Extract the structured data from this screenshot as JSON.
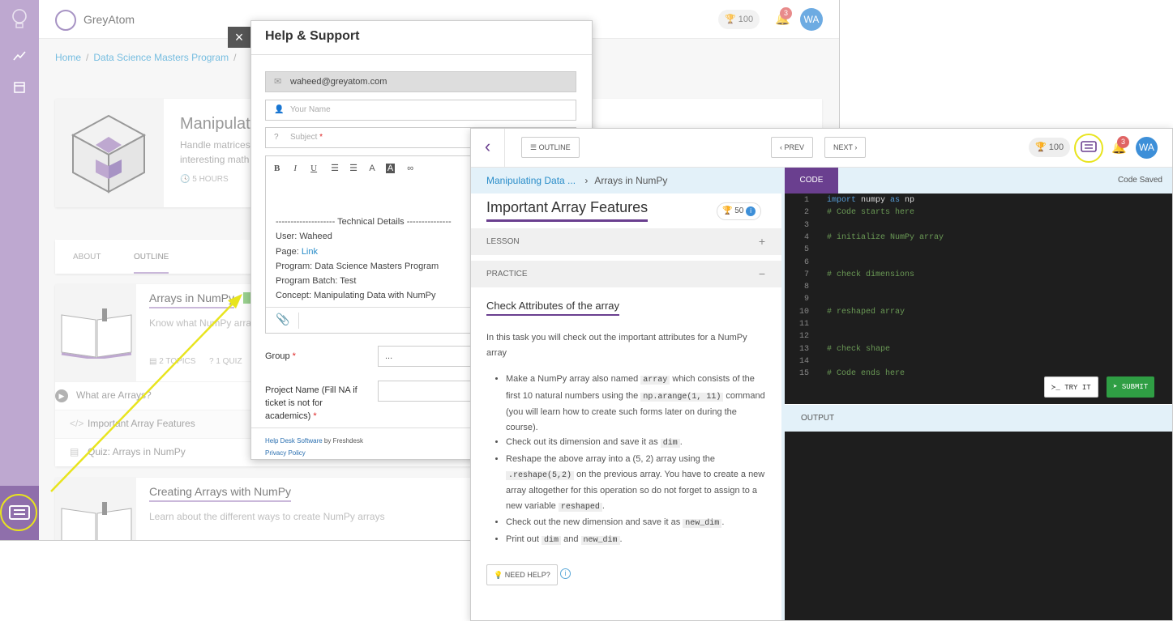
{
  "brand": {
    "name": "GreyAtom"
  },
  "header": {
    "trophy_points": "100",
    "notification_count": "3",
    "avatar_initials": "WA"
  },
  "breadcrumb": {
    "home": "Home",
    "program": "Data Science Masters Program"
  },
  "concept": {
    "title": "Manipulat",
    "desc_line1": "Handle matrices",
    "desc_line2": "interesting math",
    "hours": "5 HOURS"
  },
  "tabs": {
    "about": "ABOUT",
    "outline": "OUTLINE"
  },
  "lessons": [
    {
      "title": "Arrays in NumPy",
      "desc": "Know what NumPy arra",
      "topics": "2 TOPICS",
      "quiz": "1 QUIZ"
    },
    {
      "title": "Creating Arrays with NumPy",
      "desc": "Learn about the different ways to create NumPy arrays"
    }
  ],
  "topic_rows": [
    "What are Arrays?",
    "Important Array Features",
    "Quiz: Arrays in NumPy"
  ],
  "help_modal": {
    "title": "Help & Support",
    "close_glyph": "×",
    "email": "waheed@greyatom.com",
    "name_placeholder": "Your Name",
    "subject_placeholder": "Subject",
    "required_mark": "*",
    "toolbar": {
      "bold": "B",
      "italic": "I",
      "underline": "U"
    },
    "tech_header": "-------------------- Technical Details ---------------",
    "tech_user": "User: Waheed",
    "tech_page_label": "Page: ",
    "tech_page_link": "Link",
    "tech_program": "Program: Data Science Masters Program",
    "tech_batch": "Program Batch: Test",
    "tech_concept": "Concept: Manipulating Data with NumPy",
    "group_label": "Group",
    "group_value": "...",
    "project_label_1": "Project Name (Fill NA if",
    "project_label_2": "ticket is not for",
    "project_label_3": "academics)",
    "footer_link": "Help Desk Software",
    "footer_by": " by Freshdesk",
    "footer_privacy": "Privacy Policy"
  },
  "lesson_view": {
    "outline_btn": "OUTLINE",
    "prev_btn": "PREV",
    "next_btn": "NEXT",
    "trophy_points": "100",
    "notification_count": "3",
    "avatar_initials": "WA",
    "crumb_concept": "Manipulating Data ...",
    "crumb_lesson": "Arrays in NumPy",
    "title": "Important Array Features",
    "points": "50",
    "section_lesson": "LESSON",
    "section_practice": "PRACTICE",
    "task_title": "Check Attributes of the array",
    "task_intro": "In this task you will check out the important attributes for a NumPy array",
    "bullets": {
      "b1_pre": "Make a NumPy array also named ",
      "b1_code1": "array",
      "b1_mid": " which consists of the first 10 natural numbers using the ",
      "b1_code2": "np.arange(1, 11)",
      "b1_post": " command (you will learn how to create such forms later on during the course).",
      "b2_pre": "Check out its dimension and save it as ",
      "b2_code": "dim",
      "b2_post": ".",
      "b3_pre": "Reshape the above array into a (5, 2) array using the ",
      "b3_code1": ".reshape(5,2)",
      "b3_mid": " on the previous array. You have to create a new array altogether for this operation so do not forget to assign to a new variable ",
      "b3_code2": "reshaped",
      "b3_post": ".",
      "b4_pre": "Check out the new dimension and save it as ",
      "b4_code": "new_dim",
      "b4_post": ".",
      "b5_pre": "Print out ",
      "b5_code1": "dim",
      "b5_mid": " and ",
      "b5_code2": "new_dim",
      "b5_post": "."
    },
    "need_help_btn": "NEED HELP?"
  },
  "code_panel": {
    "tab": "CODE",
    "status": "Code Saved",
    "lines": [
      {
        "n": "1",
        "kw1": "import",
        "t1": " numpy ",
        "kw2": "as",
        "t2": " np"
      },
      {
        "n": "2",
        "c": "# Code starts here"
      },
      {
        "n": "3",
        "c": ""
      },
      {
        "n": "4",
        "c": "# initialize NumPy array"
      },
      {
        "n": "5",
        "c": ""
      },
      {
        "n": "6",
        "c": ""
      },
      {
        "n": "7",
        "c": "# check dimensions"
      },
      {
        "n": "8",
        "c": ""
      },
      {
        "n": "9",
        "c": ""
      },
      {
        "n": "10",
        "c": "# reshaped array"
      },
      {
        "n": "11",
        "c": ""
      },
      {
        "n": "12",
        "c": ""
      },
      {
        "n": "13",
        "c": "# check shape"
      },
      {
        "n": "14",
        "c": ""
      },
      {
        "n": "15",
        "c": "# Code ends here"
      }
    ],
    "try_btn": "TRY IT",
    "submit_btn": "SUBMIT",
    "output_label": "OUTPUT"
  },
  "colors": {
    "purple": "#6a3f8f",
    "sidebar": "#a98bc0",
    "highlight": "#e8e41e",
    "submit": "#2f9e44",
    "link": "#2a8dc9"
  }
}
